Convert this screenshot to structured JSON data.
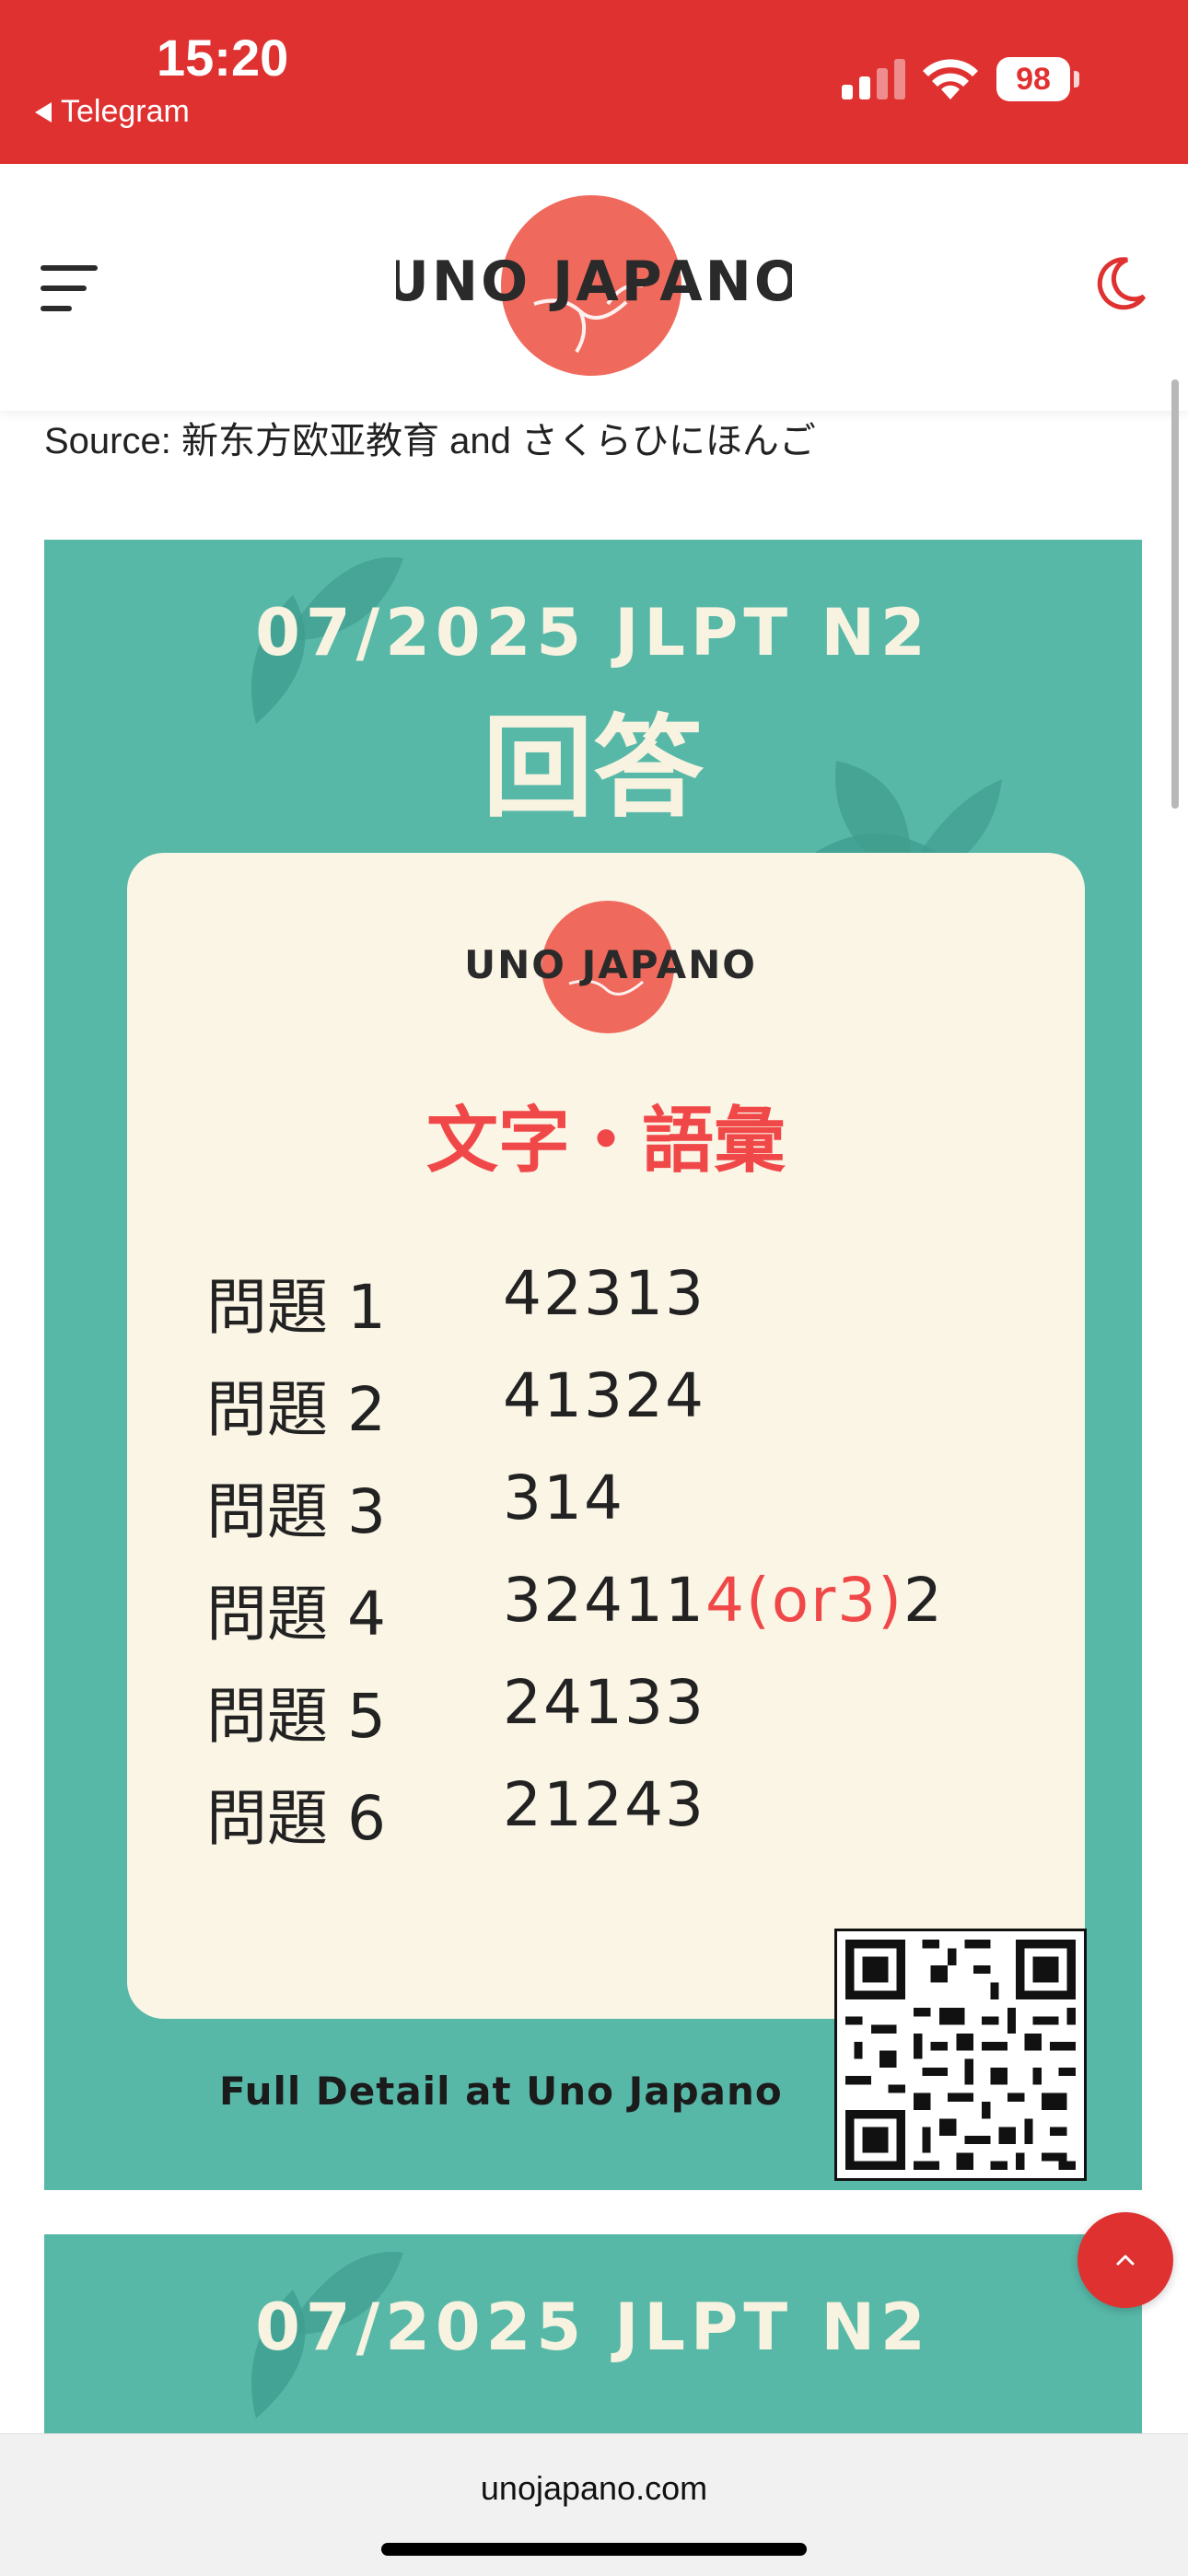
{
  "status_bar": {
    "time": "15:20",
    "back_app": "Telegram",
    "battery": "98",
    "signal_icon": "cellular-signal-icon",
    "wifi_icon": "wifi-icon",
    "battery_icon": "battery-icon",
    "background": "#e03131"
  },
  "header": {
    "logo_text": "UNO JAPANO",
    "menu_icon": "hamburger-menu-icon",
    "theme_icon": "moon-icon",
    "accent": "#e03131"
  },
  "article": {
    "source_text": "Source: 新东方欧亚教育 and さくらひにほんご"
  },
  "answer_card": {
    "title": "07/2025 JLPT N2",
    "kanji": "回答",
    "logo_text": "UNO JAPANO",
    "section": "文字・語彙",
    "rows": [
      {
        "label": "問題 1",
        "value": "42313",
        "highlight": "",
        "suffix": ""
      },
      {
        "label": "問題 2",
        "value": "41324",
        "highlight": "",
        "suffix": ""
      },
      {
        "label": "問題 3",
        "value": "314",
        "highlight": "",
        "suffix": ""
      },
      {
        "label": "問題 4",
        "value": "32411",
        "highlight": "4(or3)",
        "suffix": "2"
      },
      {
        "label": "問題 5",
        "value": "24133",
        "highlight": "",
        "suffix": ""
      },
      {
        "label": "問題 6",
        "value": "21243",
        "highlight": "",
        "suffix": ""
      }
    ],
    "footer": "Full Detail at Uno Japano",
    "qr_icon": "qr-code-icon",
    "background": "#58b8a8",
    "panel_color": "#fbf5e6",
    "highlight_color": "#f04848"
  },
  "answer_card_2": {
    "title": "07/2025 JLPT N2"
  },
  "scroll_top_icon": "chevron-up-icon",
  "browser": {
    "url": "unojapano.com"
  }
}
